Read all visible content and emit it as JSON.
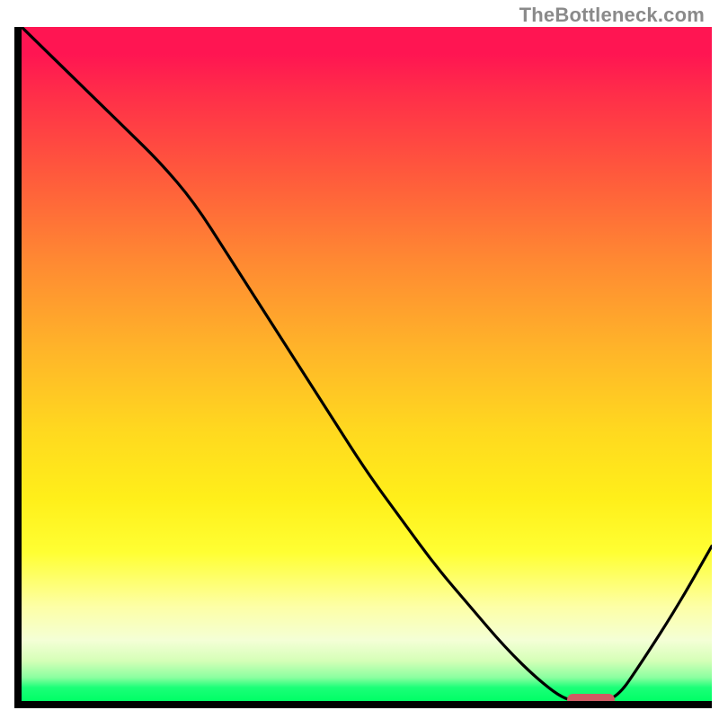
{
  "attribution": "TheBottleneck.com",
  "colors": {
    "axis": "#000000",
    "curve": "#000000",
    "marker": "#cf5b63",
    "gradient_top": "#ff1552",
    "gradient_bottom": "#00ff66",
    "attribution": "#8a8a8a"
  },
  "chart_data": {
    "type": "line",
    "title": "",
    "xlabel": "",
    "ylabel": "",
    "xlim": [
      0,
      100
    ],
    "ylim": [
      0,
      100
    ],
    "grid": false,
    "legend": false,
    "notes": "Single unlabeled line on a vertical red→green gradient. Values estimated from curve height (y=0 bottom/green, y=100 top/red). Marker shows optimal flat region near x≈79–86.",
    "x": [
      0,
      5,
      10,
      15,
      20,
      25,
      30,
      35,
      40,
      45,
      50,
      55,
      60,
      65,
      70,
      75,
      79,
      82,
      86,
      90,
      95,
      100
    ],
    "values": [
      100,
      95,
      90,
      85,
      80,
      74,
      66,
      58,
      50,
      42,
      34,
      27,
      20,
      14,
      8,
      3,
      0,
      0,
      0,
      6,
      14,
      23
    ],
    "marker": {
      "x_start": 79,
      "x_end": 86,
      "y": 0
    }
  }
}
